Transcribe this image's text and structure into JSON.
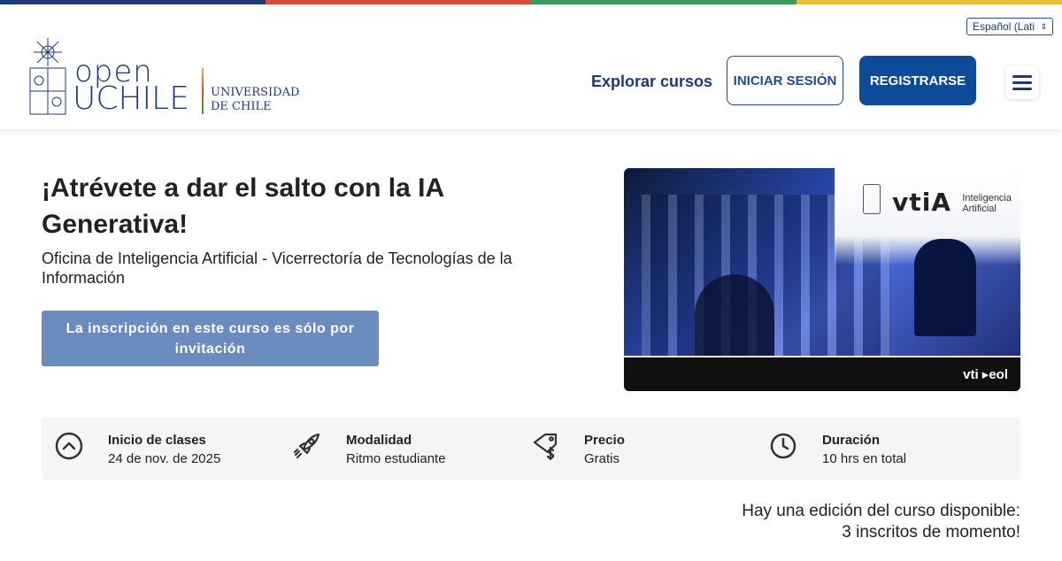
{
  "stripe_colors": [
    "#1d3a78",
    "#d94a3a",
    "#3a9a5a",
    "#e8c03a"
  ],
  "header": {
    "language_select": "Español (Lati",
    "logo": {
      "open": "open",
      "uchile": "UCHILE",
      "university_line1": "UNIVERSIDAD",
      "university_line2": "DE CHILE"
    },
    "explore_label": "Explorar cursos",
    "login_label": "INICIAR SESIÓN",
    "register_label": "REGISTRARSE",
    "menu_icon": "hamburger-icon"
  },
  "course": {
    "title": "¡Atrévete a dar el salto con la IA Generativa!",
    "organization": "Oficina de Inteligencia Artificial - Vicerrectoría de Tecnologías de la Información",
    "enroll_button": "La inscripción en este curso es sólo por invitación",
    "image": {
      "brand": "vtiA",
      "brand_sub_line1": "Inteligencia",
      "brand_sub_line2": "Artificial",
      "footer_logos": "vti ▸eol"
    }
  },
  "info": [
    {
      "icon": "chevron-up-circle-icon",
      "label": "Inicio de clases",
      "value": "24 de nov. de 2025"
    },
    {
      "icon": "rocket-icon",
      "label": "Modalidad",
      "value": "Ritmo estudiante"
    },
    {
      "icon": "price-tag-icon",
      "label": "Precio",
      "value": "Gratis"
    },
    {
      "icon": "clock-icon",
      "label": "Duración",
      "value": "10 hrs en total"
    }
  ],
  "editions": {
    "line1": "Hay una edición del curso disponible:",
    "line2": "3 inscritos de momento!"
  },
  "colors": {
    "primary": "#0e4a9a",
    "invite_button": "#6a8cbf",
    "info_bar_bg": "#f5f5f5"
  }
}
